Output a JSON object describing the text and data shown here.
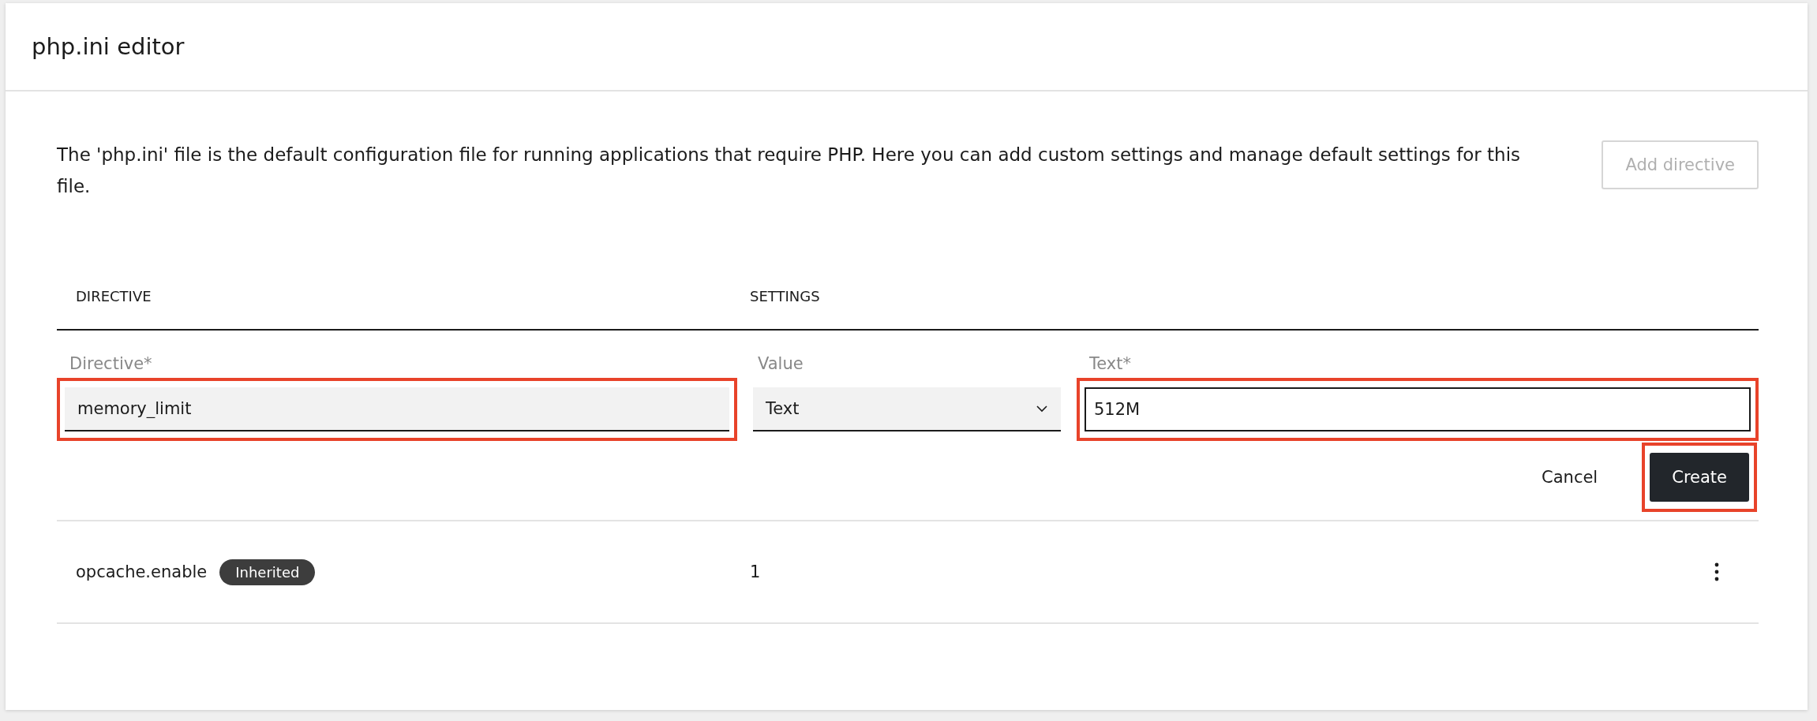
{
  "window": {
    "title": "php.ini editor"
  },
  "description": "The 'php.ini' file is the default configuration file for running applications that require PHP. Here you can add custom settings and manage default settings for this file.",
  "add_button": {
    "label": "Add directive",
    "disabled": true
  },
  "table": {
    "columns": [
      "DIRECTIVE",
      "SETTINGS"
    ],
    "new_row": {
      "directive": {
        "label": "Directive*",
        "value": "memory_limit",
        "highlighted": true
      },
      "value_type": {
        "label": "Value",
        "value": "Text",
        "highlighted": false
      },
      "text": {
        "label": "Text*",
        "value": "512M",
        "highlighted": true
      },
      "buttons": [
        {
          "label": "Cancel",
          "kind": "secondary",
          "highlighted": false
        },
        {
          "label": "Create",
          "kind": "primary",
          "highlighted": true
        }
      ]
    },
    "rows": [
      {
        "directive": "opcache.enable",
        "badge": "Inherited",
        "value": "1"
      }
    ]
  }
}
